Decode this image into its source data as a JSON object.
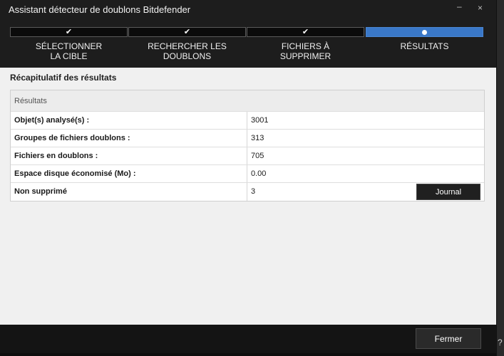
{
  "window": {
    "title": "Assistant détecteur de doublons Bitdefender",
    "minimize_glyph": "–",
    "close_glyph": "×"
  },
  "steps": [
    {
      "label_line1": "SÉLECTIONNER",
      "label_line2": "LA CIBLE",
      "state": "done",
      "icon": "check-icon"
    },
    {
      "label_line1": "RECHERCHER LES",
      "label_line2": "DOUBLONS",
      "state": "done",
      "icon": "check-icon"
    },
    {
      "label_line1": "FICHIERS À",
      "label_line2": "SUPPRIMER",
      "state": "done",
      "icon": "check-icon"
    },
    {
      "label_line1": "RÉSULTATS",
      "label_line2": "",
      "state": "active",
      "icon": "dot-icon"
    }
  ],
  "summary": {
    "title": "Récapitulatif des résultats",
    "header_label": "Résultats",
    "rows": [
      {
        "label": "Objet(s) analysé(s) :",
        "value": "3001"
      },
      {
        "label": "Groupes de fichiers doublons :",
        "value": "313"
      },
      {
        "label": "Fichiers en doublons :",
        "value": "705"
      },
      {
        "label": "Espace disque économisé (Mo) :",
        "value": "0.00"
      },
      {
        "label": "Non supprimé",
        "value": "3"
      }
    ],
    "journal_label": "Journal"
  },
  "footer": {
    "close_label": "Fermer"
  },
  "side": {
    "help_glyph": "?"
  },
  "colors": {
    "accent": "#3a78c8",
    "dark_bg": "#1d1d1d",
    "content_bg": "#f0f0f0"
  }
}
